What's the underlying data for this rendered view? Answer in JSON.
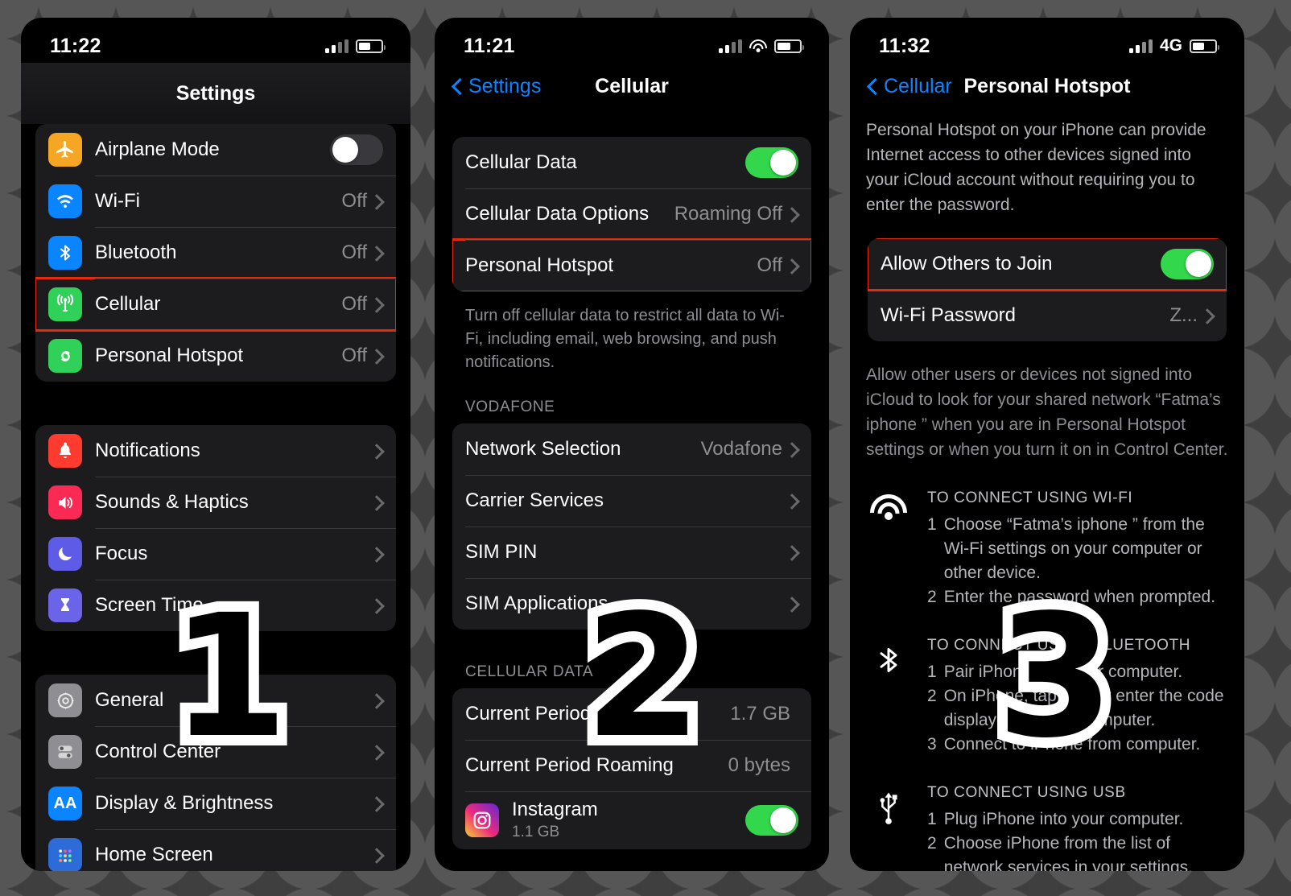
{
  "step_numbers": [
    "1",
    "2",
    "3"
  ],
  "phone1": {
    "status": {
      "time": "11:22",
      "battery_pct": 55
    },
    "nav": {
      "title": "Settings"
    },
    "group1": [
      {
        "label": "Airplane Mode",
        "icon": "airplane-icon",
        "icon_color": "#f5a623",
        "control": "toggle",
        "toggle_on": false
      },
      {
        "label": "Wi-Fi",
        "icon": "wifi-icon",
        "icon_color": "#0a84ff",
        "value": "Off",
        "control": "chevron"
      },
      {
        "label": "Bluetooth",
        "icon": "bluetooth-icon",
        "icon_color": "#0a84ff",
        "value": "Off",
        "control": "chevron"
      },
      {
        "label": "Cellular",
        "icon": "cellular-icon",
        "icon_color": "#30d158",
        "value": "Off",
        "control": "chevron",
        "highlight": true
      },
      {
        "label": "Personal Hotspot",
        "icon": "hotspot-icon",
        "icon_color": "#30d158",
        "value": "Off",
        "control": "chevron"
      }
    ],
    "group2": [
      {
        "label": "Notifications",
        "icon": "bell-icon",
        "icon_color": "#ff3b30",
        "control": "chevron"
      },
      {
        "label": "Sounds & Haptics",
        "icon": "speaker-icon",
        "icon_color": "#fa2a55",
        "control": "chevron"
      },
      {
        "label": "Focus",
        "icon": "moon-icon",
        "icon_color": "#5e5ce6",
        "control": "chevron"
      },
      {
        "label": "Screen Time",
        "icon": "hourglass-icon",
        "icon_color": "#5e5ce6",
        "control": "chevron"
      }
    ],
    "group3": [
      {
        "label": "General",
        "icon": "gear-icon",
        "icon_color": "#8e8e93",
        "control": "chevron"
      },
      {
        "label": "Control Center",
        "icon": "sliders-icon",
        "icon_color": "#8e8e93",
        "control": "chevron"
      },
      {
        "label": "Display & Brightness",
        "icon": "aa-icon",
        "icon_color": "#0a84ff",
        "control": "chevron"
      },
      {
        "label": "Home Screen",
        "icon": "grid-icon",
        "icon_color": "#2d6bd8",
        "control": "chevron"
      }
    ]
  },
  "phone2": {
    "status": {
      "time": "11:21",
      "battery_pct": 60
    },
    "nav": {
      "back_label": "Settings",
      "title": "Cellular"
    },
    "group1": [
      {
        "label": "Cellular Data",
        "control": "toggle",
        "toggle_on": true
      },
      {
        "label": "Cellular Data Options",
        "value": "Roaming Off",
        "control": "chevron"
      },
      {
        "label": "Personal Hotspot",
        "value": "Off",
        "control": "chevron",
        "highlight": true
      }
    ],
    "footnote1": "Turn off cellular data to restrict all data to Wi-Fi, including email, web browsing, and push notifications.",
    "header_carrier": "VODAFONE",
    "group2": [
      {
        "label": "Network Selection",
        "value": "Vodafone",
        "control": "chevron"
      },
      {
        "label": "Carrier Services",
        "control": "chevron"
      },
      {
        "label": "SIM PIN",
        "control": "chevron"
      },
      {
        "label": "SIM Applications",
        "control": "chevron"
      }
    ],
    "header_data": "CELLULAR DATA",
    "group3": [
      {
        "label": "Current Period",
        "value": "1.7 GB",
        "control": "none"
      },
      {
        "label": "Current Period Roaming",
        "value": "0 bytes",
        "control": "none"
      },
      {
        "label": "Instagram",
        "sublabel": "1.1 GB",
        "icon": "instagram-icon",
        "control": "toggle",
        "toggle_on": true
      }
    ]
  },
  "phone3": {
    "status": {
      "time": "11:32",
      "network": "4G",
      "battery_pct": 55
    },
    "nav": {
      "back_label": "Cellular",
      "title": "Personal Hotspot"
    },
    "intro": "Personal Hotspot on your iPhone can provide Internet access to other devices signed into your iCloud account without requiring you to enter the password.",
    "group1": [
      {
        "label": "Allow Others to Join",
        "control": "toggle",
        "toggle_on": true,
        "highlight": true
      },
      {
        "label": "Wi-Fi Password",
        "value": "Z...",
        "control": "chevron"
      }
    ],
    "footnote1": "Allow other users or devices not signed into iCloud to look for your shared network “Fatma’s iphone ” when you are in Personal Hotspot settings or when you turn it on in Control Center.",
    "instructions": [
      {
        "icon": "wifi-icon",
        "title": "TO CONNECT USING WI-FI",
        "steps": [
          {
            "n": "1",
            "text": "Choose “Fatma’s iphone ” from the Wi-Fi settings on your computer or other device."
          },
          {
            "n": "2",
            "text": "Enter the password when prompted."
          }
        ]
      },
      {
        "icon": "bluetooth-icon",
        "title": "TO CONNECT USING BLUETOOTH",
        "steps": [
          {
            "n": "1",
            "text": "Pair iPhone with your computer."
          },
          {
            "n": "2",
            "text": "On iPhone, tap Pair or enter the code displayed on your computer."
          },
          {
            "n": "3",
            "text": "Connect to iPhone from computer."
          }
        ]
      },
      {
        "icon": "usb-icon",
        "title": "TO CONNECT USING USB",
        "steps": [
          {
            "n": "1",
            "text": "Plug iPhone into your computer."
          },
          {
            "n": "2",
            "text": "Choose iPhone from the list of network services in your settings."
          }
        ]
      }
    ]
  },
  "colors": {
    "highlight": "#e8290b",
    "accent_blue": "#0a84ff",
    "toggle_on": "#32d74b",
    "group_bg": "#1c1c1e",
    "secondary_text": "#8e8e93"
  }
}
